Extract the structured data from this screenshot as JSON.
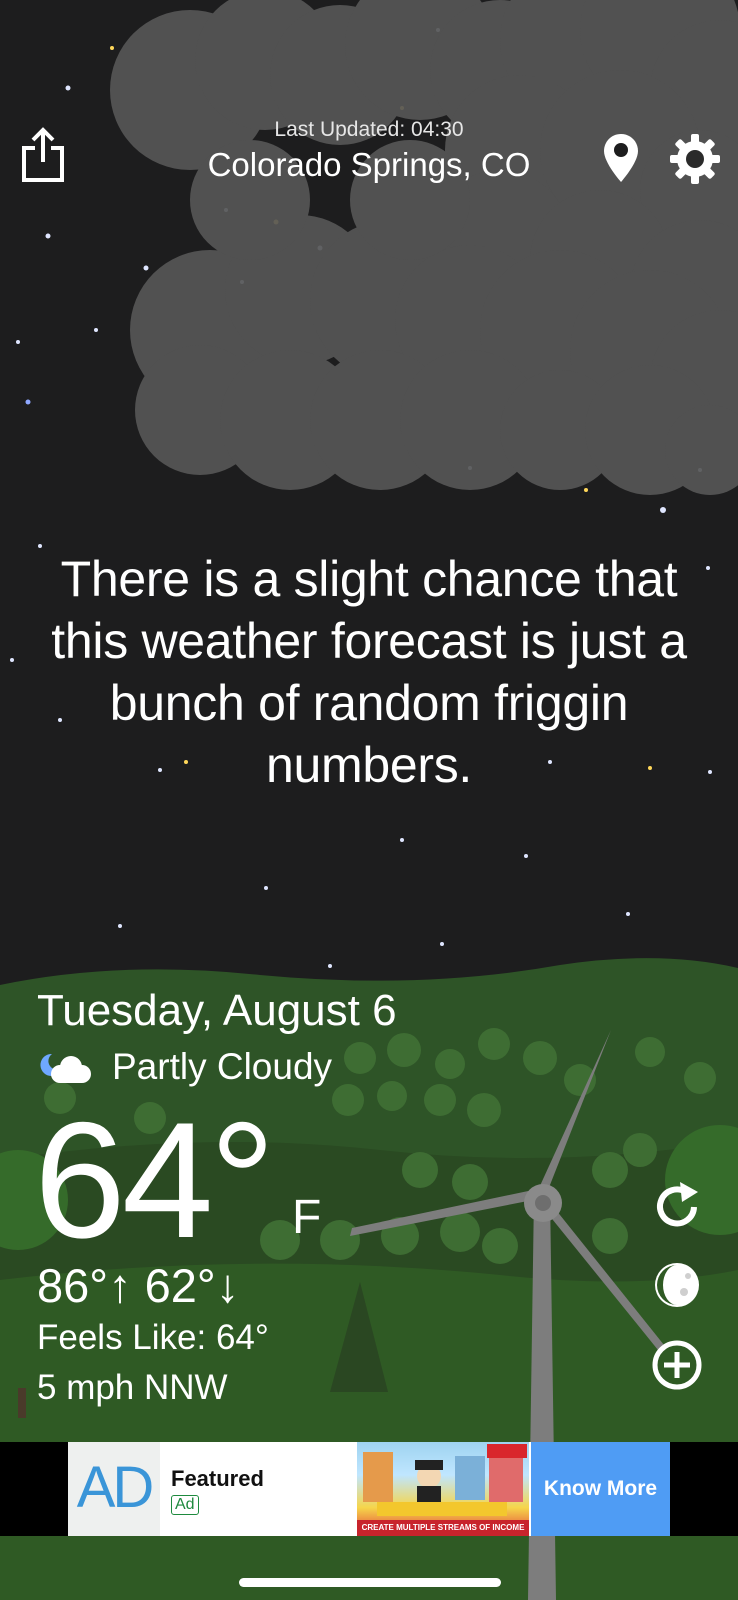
{
  "header": {
    "last_updated": "Last Updated: 04:30",
    "location": "Colorado Springs, CO"
  },
  "message": "There is a slight chance that this weather forecast is just a bunch of random friggin numbers.",
  "weather": {
    "date": "Tuesday, August 6",
    "condition": "Partly Cloudy",
    "condition_icon": "partly-cloudy-night-icon",
    "temperature": "64°",
    "unit": "F",
    "high_low": "86°↑ 62°↓",
    "feels_like": "Feels Like: 64°",
    "wind": "5 mph NNW"
  },
  "toolbar_icons": [
    "share-icon",
    "location-pin-icon",
    "gear-icon"
  ],
  "side_buttons": [
    "refresh-icon",
    "moon-icon",
    "plus-circle-icon"
  ],
  "ad": {
    "logo_text": "AD",
    "title": "Featured",
    "badge": "Ad",
    "image_caption": "CREATE MULTIPLE STREAMS OF INCOME",
    "cta": "Know More"
  },
  "colors": {
    "sky": "#1d1d1e",
    "cloud": "#555555",
    "grass": "#274a1f",
    "ad_cta": "#4f9cf4"
  }
}
